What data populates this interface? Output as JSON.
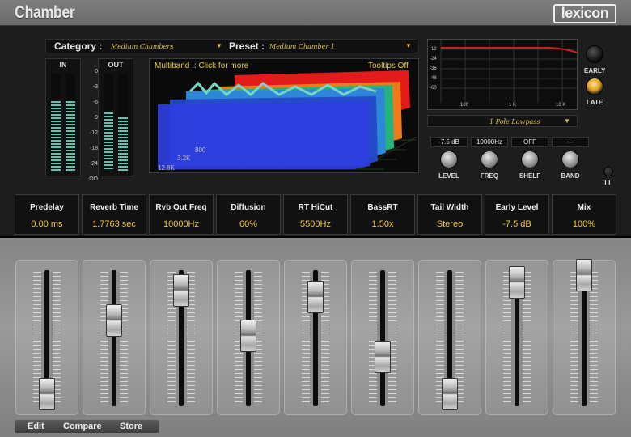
{
  "app": {
    "title": "Chamber",
    "logo": "lexicon"
  },
  "category": {
    "label": "Category :",
    "value": "Medium Chambers"
  },
  "preset": {
    "label": "Preset :",
    "value": "Medium Chamber 1"
  },
  "meters": {
    "in_label": "IN",
    "out_label": "OUT",
    "scale": [
      "0",
      "-3",
      "-6",
      "-9",
      "-12",
      "-18",
      "-24",
      "OO"
    ],
    "in_levels": [
      0.72,
      0.72
    ],
    "out_levels": [
      0.6,
      0.55
    ]
  },
  "display": {
    "multiband": "Multiband :: Click for more",
    "tooltips": "Tooltips Off",
    "freq_labels": [
      "12.8K",
      "3.2K",
      "800"
    ]
  },
  "eq": {
    "db_ticks": [
      "-12",
      "-24",
      "-36",
      "-48",
      "-60"
    ],
    "freq_ticks": [
      "100",
      "1 K",
      "10 K"
    ],
    "filter_type": "1 Pole Lowpass"
  },
  "controls": {
    "level_value": "-7.5 dB",
    "freq_value": "10000Hz",
    "shelf_value": "OFF",
    "band_value": "---",
    "level_label": "LEVEL",
    "freq_label": "FREQ",
    "shelf_label": "SHELF",
    "band_label": "BAND"
  },
  "er": {
    "early_label": "EARLY",
    "late_label": "LATE",
    "tt_label": "TT"
  },
  "params": [
    {
      "name": "Predelay",
      "value": "0.00 ms"
    },
    {
      "name": "Reverb Time",
      "value": "1.7763 sec"
    },
    {
      "name": "Rvb Out Freq",
      "value": "10000Hz"
    },
    {
      "name": "Diffusion",
      "value": "60%"
    },
    {
      "name": "RT HiCut",
      "value": "5500Hz"
    },
    {
      "name": "BassRT",
      "value": "1.50x"
    },
    {
      "name": "Tail Width",
      "value": "Stereo"
    },
    {
      "name": "Early Level",
      "value": "-7.5 dB"
    },
    {
      "name": "Mix",
      "value": "100%"
    }
  ],
  "faders": [
    0.06,
    0.64,
    0.88,
    0.52,
    0.83,
    0.35,
    0.06,
    0.94,
    1.0
  ],
  "bottom": {
    "edit": "Edit",
    "compare": "Compare",
    "store": "Store"
  },
  "colors": {
    "accent": "#ecc93b",
    "meter": "#4fc9b2",
    "eq_curve": "#d02020"
  }
}
